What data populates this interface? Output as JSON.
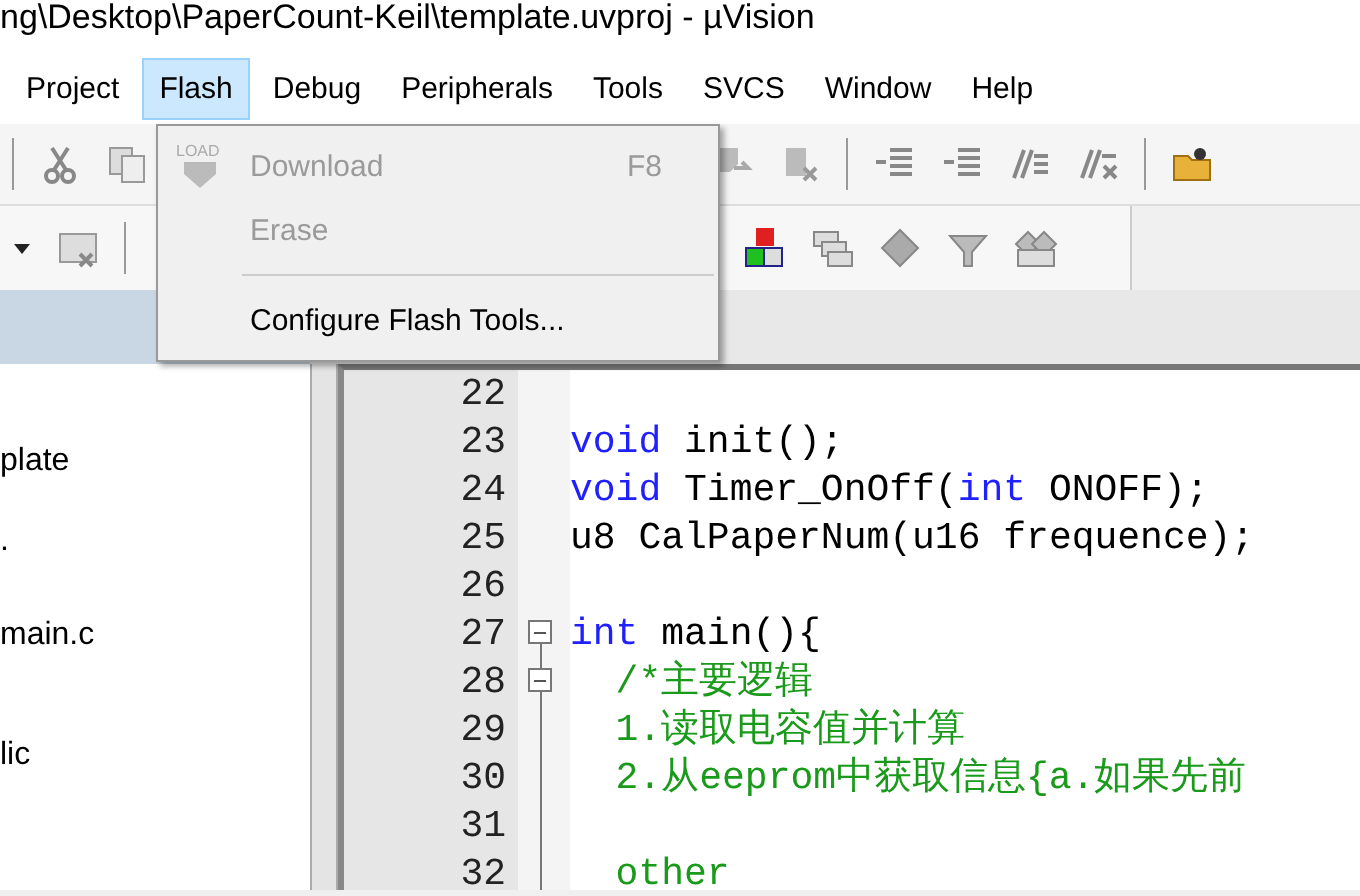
{
  "window": {
    "title": "ng\\Desktop\\PaperCount-Keil\\template.uvproj - µVision"
  },
  "menu_bar": [
    {
      "label": "Project",
      "selected": false
    },
    {
      "label": "Flash",
      "selected": true
    },
    {
      "label": "Debug",
      "selected": false
    },
    {
      "label": "Peripherals",
      "selected": false
    },
    {
      "label": "Tools",
      "selected": false
    },
    {
      "label": "SVCS",
      "selected": false
    },
    {
      "label": "Window",
      "selected": false
    },
    {
      "label": "Help",
      "selected": false
    }
  ],
  "flash_menu": [
    {
      "kind": "item",
      "label": "Download",
      "shortcut": "F8",
      "disabled": true,
      "icon_caption": "LOAD"
    },
    {
      "kind": "item",
      "label": "Erase",
      "disabled": true
    },
    {
      "kind": "separator"
    },
    {
      "kind": "item",
      "label": "Configure Flash Tools...",
      "disabled": false
    }
  ],
  "project_tree": [
    "plate",
    ".",
    "main.c",
    "lic"
  ],
  "editor": {
    "lines": [
      {
        "number": "22",
        "collapsible": false
      },
      {
        "number": "23",
        "collapsible": false,
        "tokens": [
          {
            "kind": "keyword",
            "text": "void"
          },
          {
            "kind": "plain",
            "text": " init();"
          }
        ]
      },
      {
        "number": "24",
        "collapsible": false,
        "tokens": [
          {
            "kind": "keyword",
            "text": "void"
          },
          {
            "kind": "plain",
            "text": " Timer_OnOff("
          },
          {
            "kind": "keyword",
            "text": "int"
          },
          {
            "kind": "plain",
            "text": " ONOFF);"
          }
        ]
      },
      {
        "number": "25",
        "collapsible": false,
        "tokens": [
          {
            "kind": "plain",
            "text": "u8 CalPaperNum(u16 frequence);"
          }
        ]
      },
      {
        "number": "26",
        "collapsible": false
      },
      {
        "number": "27",
        "collapsible": true,
        "tokens": [
          {
            "kind": "keyword",
            "text": "int"
          },
          {
            "kind": "plain",
            "text": " main(){"
          }
        ]
      },
      {
        "number": "28",
        "collapsible": true,
        "tokens": [
          {
            "kind": "comment",
            "text": "  /*主要逻辑"
          }
        ]
      },
      {
        "number": "29",
        "collapsible": false,
        "tokens": [
          {
            "kind": "comment",
            "text": "  1.读取电容值并计算"
          }
        ]
      },
      {
        "number": "30",
        "collapsible": false,
        "tokens": [
          {
            "kind": "comment",
            "text": "  2.从eeprom中获取信息{a.如果先前"
          }
        ]
      },
      {
        "number": "31",
        "collapsible": false
      },
      {
        "number": "32",
        "collapsible": false,
        "tokens": [
          {
            "kind": "comment",
            "text": "  other"
          }
        ]
      }
    ]
  }
}
